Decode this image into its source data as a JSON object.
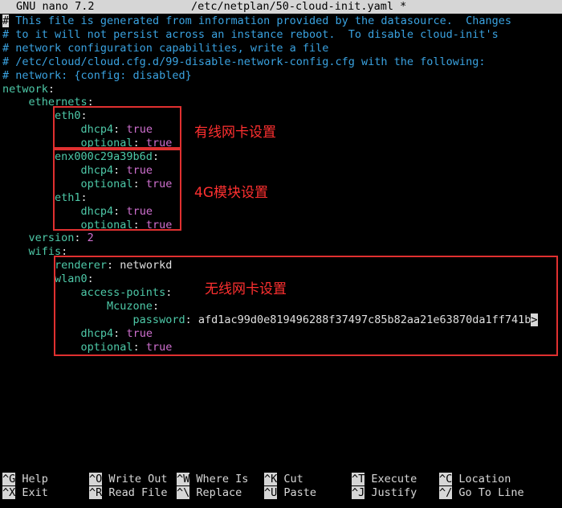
{
  "titlebar": {
    "app": "GNU nano 7.2",
    "file": "/etc/netplan/50-cloud-init.yaml *"
  },
  "lines": [
    {
      "parts": [
        {
          "t": "#",
          "c": "cursor-hash"
        },
        {
          "t": " This file is generated from information provided by the datasource.  Changes",
          "c": "comment"
        }
      ]
    },
    {
      "parts": [
        {
          "t": "# to it will not persist across an instance reboot.  To disable cloud-init's",
          "c": "comment"
        }
      ]
    },
    {
      "parts": [
        {
          "t": "# network configuration capabilities, write a file",
          "c": "comment"
        }
      ]
    },
    {
      "parts": [
        {
          "t": "# /etc/cloud/cloud.cfg.d/99-disable-network-config.cfg with the following:",
          "c": "comment"
        }
      ]
    },
    {
      "parts": [
        {
          "t": "# network: {config: disabled}",
          "c": "comment"
        }
      ]
    },
    {
      "parts": [
        {
          "t": "network",
          "c": "key"
        },
        {
          "t": ":",
          "c": "val"
        }
      ]
    },
    {
      "parts": [
        {
          "t": "    ethernets",
          "c": "key"
        },
        {
          "t": ":",
          "c": "val"
        }
      ]
    },
    {
      "parts": [
        {
          "t": "        eth0",
          "c": "key"
        },
        {
          "t": ":",
          "c": "val"
        }
      ]
    },
    {
      "parts": [
        {
          "t": "            dhcp4",
          "c": "key"
        },
        {
          "t": ": ",
          "c": "val"
        },
        {
          "t": "true",
          "c": "kw"
        }
      ]
    },
    {
      "parts": [
        {
          "t": "            optional",
          "c": "key"
        },
        {
          "t": ": ",
          "c": "val"
        },
        {
          "t": "true",
          "c": "kw"
        }
      ]
    },
    {
      "parts": [
        {
          "t": "        enx000c29a39b6d",
          "c": "key"
        },
        {
          "t": ":",
          "c": "val"
        }
      ]
    },
    {
      "parts": [
        {
          "t": "            dhcp4",
          "c": "key"
        },
        {
          "t": ": ",
          "c": "val"
        },
        {
          "t": "true",
          "c": "kw"
        }
      ]
    },
    {
      "parts": [
        {
          "t": "            optional",
          "c": "key"
        },
        {
          "t": ": ",
          "c": "val"
        },
        {
          "t": "true",
          "c": "kw"
        }
      ]
    },
    {
      "parts": [
        {
          "t": "        eth1",
          "c": "key"
        },
        {
          "t": ":",
          "c": "val"
        }
      ]
    },
    {
      "parts": [
        {
          "t": "            dhcp4",
          "c": "key"
        },
        {
          "t": ": ",
          "c": "val"
        },
        {
          "t": "true",
          "c": "kw"
        }
      ]
    },
    {
      "parts": [
        {
          "t": "            optional",
          "c": "key"
        },
        {
          "t": ": ",
          "c": "val"
        },
        {
          "t": "true",
          "c": "kw"
        }
      ]
    },
    {
      "parts": [
        {
          "t": "    version",
          "c": "key"
        },
        {
          "t": ": ",
          "c": "val"
        },
        {
          "t": "2",
          "c": "num"
        }
      ]
    },
    {
      "parts": [
        {
          "t": "    wifis",
          "c": "key"
        },
        {
          "t": ":",
          "c": "val"
        }
      ]
    },
    {
      "parts": [
        {
          "t": "        renderer",
          "c": "key"
        },
        {
          "t": ": networkd",
          "c": "val"
        }
      ]
    },
    {
      "parts": [
        {
          "t": "        wlan0",
          "c": "key"
        },
        {
          "t": ":",
          "c": "val"
        }
      ]
    },
    {
      "parts": [
        {
          "t": "            access-points",
          "c": "key"
        },
        {
          "t": ":",
          "c": "val"
        }
      ]
    },
    {
      "parts": [
        {
          "t": "                Mcuzone",
          "c": "key"
        },
        {
          "t": ":",
          "c": "val"
        }
      ]
    },
    {
      "parts": [
        {
          "t": "                    password",
          "c": "key"
        },
        {
          "t": ": afd1ac99d0e819496288f37497c85b82aa21e63870da1ff741b",
          "c": "val"
        },
        {
          "t": ">",
          "c": "cursorblk"
        }
      ]
    },
    {
      "parts": [
        {
          "t": "            dhcp4",
          "c": "key"
        },
        {
          "t": ": ",
          "c": "val"
        },
        {
          "t": "true",
          "c": "kw"
        }
      ]
    },
    {
      "parts": [
        {
          "t": "            optional",
          "c": "key"
        },
        {
          "t": ": ",
          "c": "val"
        },
        {
          "t": "true",
          "c": "kw"
        }
      ]
    }
  ],
  "annotations": {
    "wired": "有线网卡设置",
    "module4g": "4G模块设置",
    "wireless": "无线网卡设置"
  },
  "shortcuts": [
    {
      "key": "^G",
      "label": " Help"
    },
    {
      "key": "^X",
      "label": " Exit"
    },
    {
      "key": "^O",
      "label": " Write Out"
    },
    {
      "key": "^R",
      "label": " Read File"
    },
    {
      "key": "^W",
      "label": " Where Is"
    },
    {
      "key": "^\\",
      "label": " Replace"
    },
    {
      "key": "^K",
      "label": " Cut"
    },
    {
      "key": "^U",
      "label": " Paste"
    },
    {
      "key": "^T",
      "label": " Execute"
    },
    {
      "key": "^J",
      "label": " Justify"
    },
    {
      "key": "^C",
      "label": " Location"
    },
    {
      "key": "^/",
      "label": " Go To Line"
    }
  ],
  "colors": {
    "annotation": "#e03030",
    "comment": "#3aa2e0",
    "key": "#4ec9a8",
    "keyword": "#d070d0"
  }
}
